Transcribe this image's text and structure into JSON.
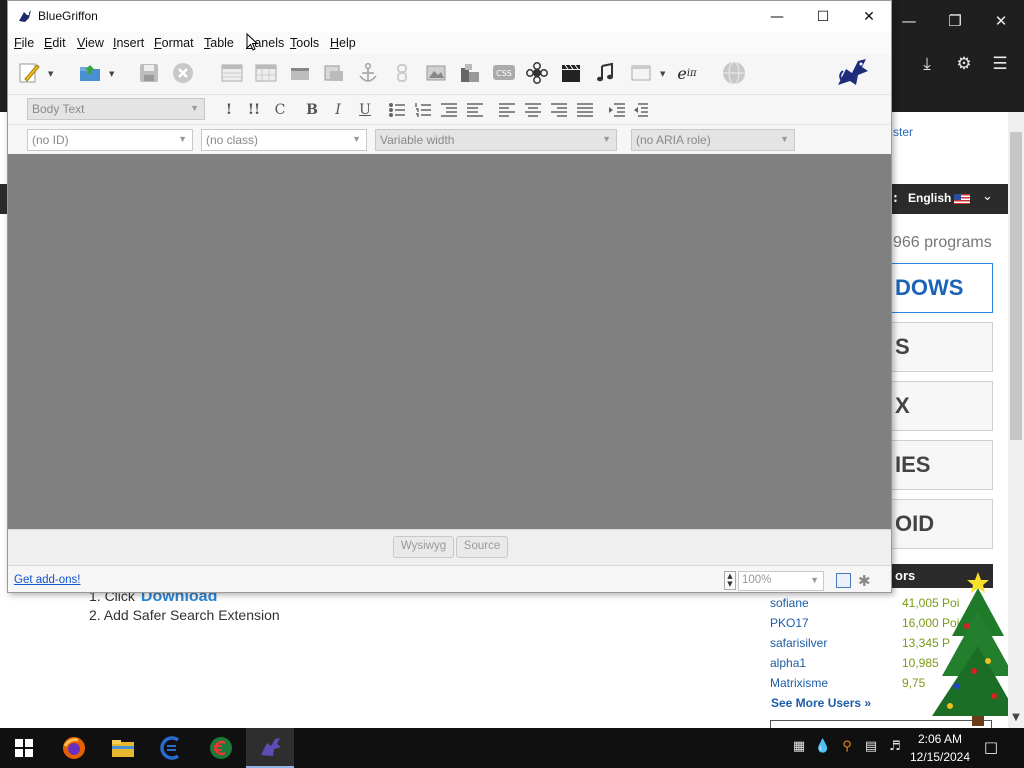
{
  "browser": {
    "register_link": "ster",
    "language_colon": ":",
    "language_label": "English",
    "programs_count": "966 programs",
    "platform_buttons": [
      "DOWS",
      "S",
      "X",
      "IES",
      "OID"
    ],
    "top_users_header": "ors",
    "top_users": [
      {
        "name": "sofiane",
        "points": "41,005 Poi"
      },
      {
        "name": "PKO17",
        "points": "16,000 Poi"
      },
      {
        "name": "safarisilver",
        "points": "13,345 P"
      },
      {
        "name": "alpha1",
        "points": "10,985"
      },
      {
        "name": "Matrixisme",
        "points": "9,75"
      }
    ],
    "see_more": "See More Users »",
    "steps": {
      "step1_prefix": "1. Click",
      "step1_link": "Download",
      "step2": "2. Add Safer Search Extension"
    }
  },
  "app": {
    "title": "BlueGriffon",
    "menu": [
      "File",
      "Edit",
      "View",
      "Insert",
      "Format",
      "Table",
      "Panels",
      "Tools",
      "Help"
    ],
    "paragraph_format": "Body Text",
    "format_buttons": [
      "!",
      "!!",
      "C",
      "B",
      "I",
      "U"
    ],
    "id_select": "(no ID)",
    "class_select": "(no class)",
    "width_select": "Variable width",
    "aria_select": "(no ARIA role)",
    "mode_tabs": [
      "Wysiwyg",
      "Source"
    ],
    "get_addons": "Get add-ons!",
    "zoom": "100%",
    "math_symbol": "e",
    "math_exponent": "iπ",
    "css_label": "CSS"
  },
  "taskbar": {
    "time": "2:06 AM",
    "date": "12/15/2024"
  },
  "colors": {
    "editor_bg": "#808080",
    "link": "#1155cc",
    "browser_dark": "#1f1f1f",
    "taskbar": "#101010"
  }
}
